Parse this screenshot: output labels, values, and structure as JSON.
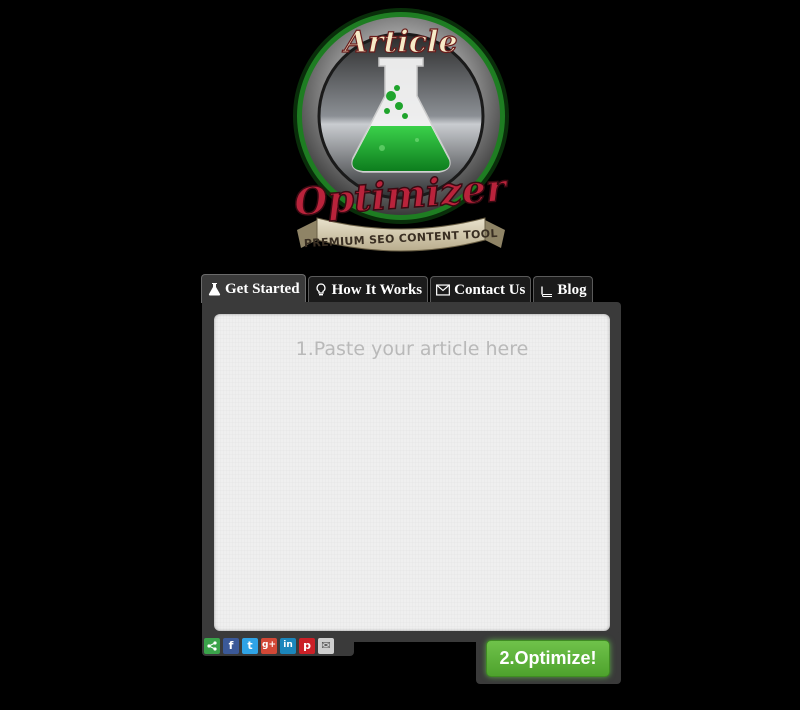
{
  "logo": {
    "title_top": "Article",
    "title_main": "Optimizer",
    "tagline": "PREMIUM SEO CONTENT TOOL"
  },
  "tabs": [
    {
      "label": "Get Started",
      "icon": "flask-icon",
      "active": true
    },
    {
      "label": "How It Works",
      "icon": "lightbulb-icon",
      "active": false
    },
    {
      "label": "Contact Us",
      "icon": "envelope-icon",
      "active": false
    },
    {
      "label": "Blog",
      "icon": "book-icon",
      "active": false
    }
  ],
  "editor": {
    "placeholder": "1.Paste your article here",
    "value": ""
  },
  "share": [
    {
      "network": "share",
      "glyph": "<",
      "color": "#3aa34a"
    },
    {
      "network": "facebook",
      "glyph": "f",
      "color": "#3b5998"
    },
    {
      "network": "twitter",
      "glyph": "t",
      "color": "#2fa3e6"
    },
    {
      "network": "google-plus",
      "glyph": "g+",
      "color": "#d34836"
    },
    {
      "network": "linkedin",
      "glyph": "in",
      "color": "#1b86bc"
    },
    {
      "network": "pinterest",
      "glyph": "p",
      "color": "#cb2027"
    },
    {
      "network": "email",
      "glyph": "✉",
      "color": "#cfcfcf"
    }
  ],
  "optimize_button": {
    "label": "2.Optimize!"
  },
  "colors": {
    "background": "#000000",
    "panel": "#3a3a3a",
    "accent_green": "#5cb33a",
    "logo_red": "#b9233b"
  }
}
